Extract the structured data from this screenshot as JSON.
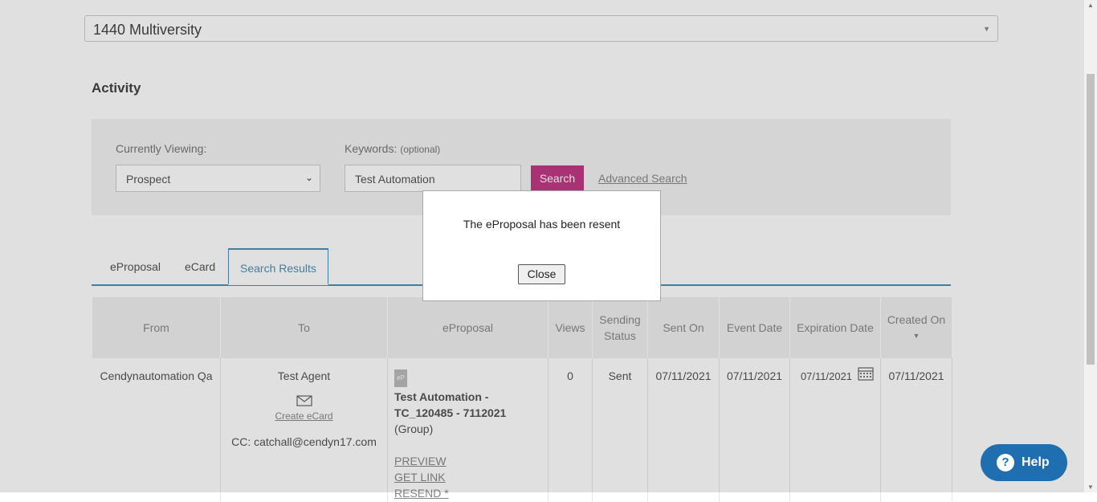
{
  "property": {
    "selected": "1440 Multiversity"
  },
  "activity": {
    "heading": "Activity"
  },
  "search": {
    "viewing_label": "Currently Viewing:",
    "viewing_value": "Prospect",
    "keywords_label": "Keywords:",
    "keywords_optional": "(optional)",
    "keywords_value": "Test Automation",
    "search_button": "Search",
    "advanced_link": "Advanced Search"
  },
  "tabs": [
    {
      "label": "eProposal"
    },
    {
      "label": "eCard"
    },
    {
      "label": "Search Results"
    }
  ],
  "table": {
    "headers": {
      "from": "From",
      "to": "To",
      "eproposal": "eProposal",
      "views": "Views",
      "sending_status": "Sending Status",
      "sent_on": "Sent On",
      "event_date": "Event Date",
      "expiration_date": "Expiration Date",
      "created_on": "Created On"
    },
    "row": {
      "from": "Cendynautomation Qa",
      "to": "Test Agent",
      "create_ecard": "Create eCard",
      "cc": "CC:  catchall@cendyn17.com",
      "ep_badge": "eP",
      "ep_title_1": "Test Automation -",
      "ep_title_2": "TC_120485 - 7112021",
      "ep_group": "(Group)",
      "preview": "PREVIEW",
      "get_link": "GET LINK",
      "resend": "RESEND *",
      "views": "0",
      "sending_status": "Sent",
      "sent_on": "07/11/2021",
      "event_date": "07/11/2021",
      "expiration_date": "07/11/2021",
      "created_on": "07/11/2021"
    }
  },
  "modal": {
    "message": "The eProposal has been resent",
    "close_label": "Close"
  },
  "help": {
    "label": "Help"
  },
  "colors": {
    "accent": "#c13a86",
    "tab_blue": "#4a90b8",
    "help_blue": "#1f6fb0"
  }
}
